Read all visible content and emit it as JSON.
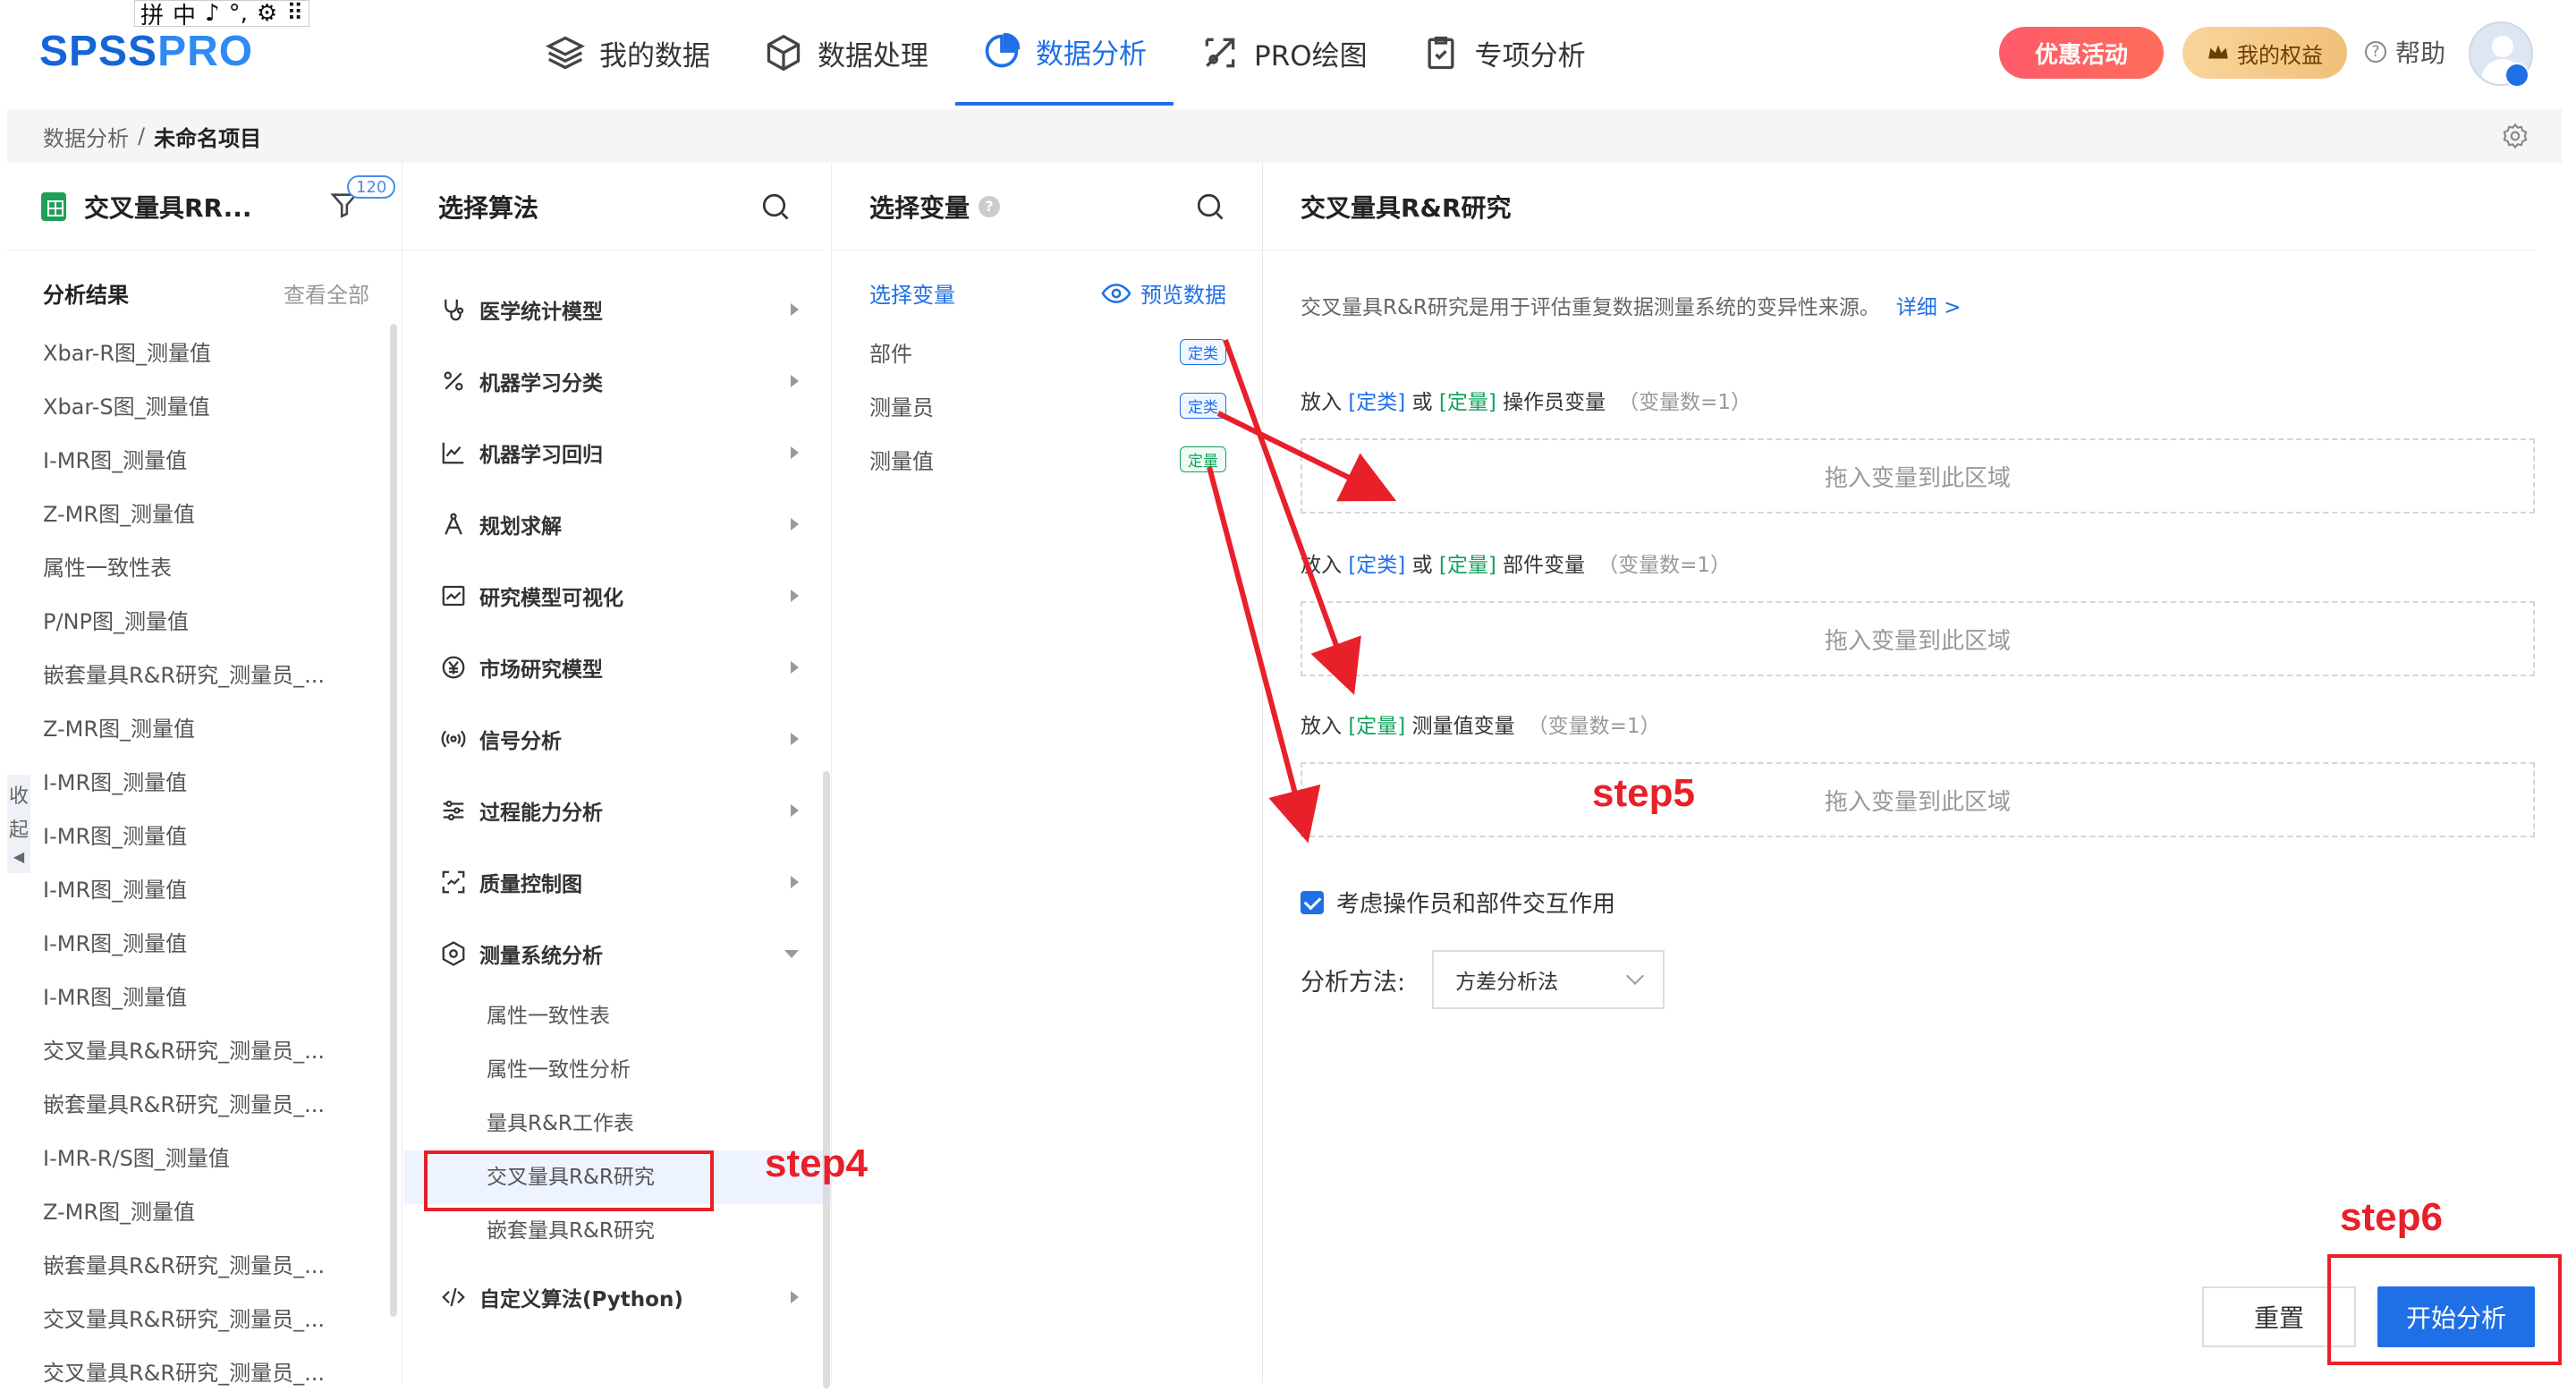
{
  "ime": {
    "items": [
      "拼",
      "中",
      "♪",
      "°,",
      "⚙",
      "⠿"
    ]
  },
  "logo": {
    "part1": "SPSS",
    "part2": "PRO"
  },
  "nav": {
    "items": [
      {
        "label": "我的数据",
        "icon": "layers-icon"
      },
      {
        "label": "数据处理",
        "icon": "cube-icon"
      },
      {
        "label": "数据分析",
        "icon": "pie-chart-icon",
        "active": true
      },
      {
        "label": "PRO绘图",
        "icon": "drawing-icon"
      },
      {
        "label": "专项分析",
        "icon": "clipboard-check-icon"
      }
    ],
    "promo": "优惠活动",
    "rights": "我的权益",
    "help": "帮助"
  },
  "breadcrumb": {
    "root": "数据分析",
    "sep": "/",
    "current": "未命名项目"
  },
  "project": {
    "name": "交叉量具RR...",
    "badge": "120"
  },
  "results": {
    "title": "分析结果",
    "view_all": "查看全部",
    "items": [
      "Xbar-R图_测量值",
      "Xbar-S图_测量值",
      "I-MR图_测量值",
      "Z-MR图_测量值",
      "属性一致性表",
      "P/NP图_测量值",
      "嵌套量具R&R研究_测量员_...",
      "Z-MR图_测量值",
      "I-MR图_测量值",
      "I-MR图_测量值",
      "I-MR图_测量值",
      "I-MR图_测量值",
      "I-MR图_测量值",
      "交叉量具R&R研究_测量员_...",
      "嵌套量具R&R研究_测量员_...",
      "I-MR-R/S图_测量值",
      "Z-MR图_测量值",
      "嵌套量具R&R研究_测量员_...",
      "交叉量具R&R研究_测量员_...",
      "交叉量具R&R研究_测量员_..."
    ],
    "collapse": [
      "收",
      "起"
    ]
  },
  "algorithms": {
    "title": "选择算法",
    "items": [
      {
        "label": "医学统计模型",
        "icon": "stethoscope-icon"
      },
      {
        "label": "机器学习分类",
        "icon": "percent-icon"
      },
      {
        "label": "机器学习回归",
        "icon": "trend-chart-icon"
      },
      {
        "label": "规划求解",
        "icon": "compass-icon"
      },
      {
        "label": "研究模型可视化",
        "icon": "line-chart-icon"
      },
      {
        "label": "市场研究模型",
        "icon": "yen-icon"
      },
      {
        "label": "信号分析",
        "icon": "signal-icon"
      },
      {
        "label": "过程能力分析",
        "icon": "sliders-icon"
      },
      {
        "label": "质量控制图",
        "icon": "scan-icon"
      },
      {
        "label": "测量系统分析",
        "icon": "gauge-icon",
        "expanded": true
      }
    ],
    "sub_items": [
      "属性一致性表",
      "属性一致性分析",
      "量具R&R工作表",
      "交叉量具R&R研究",
      "嵌套量具R&R研究"
    ],
    "last": {
      "label": "自定义算法(Python)",
      "icon": "code-icon"
    }
  },
  "variables": {
    "title": "选择变量",
    "select_label": "选择变量",
    "preview_label": "预览数据",
    "items": [
      {
        "name": "部件",
        "type": "定类"
      },
      {
        "name": "测量员",
        "type": "定类"
      },
      {
        "name": "测量值",
        "type": "定量"
      }
    ]
  },
  "config": {
    "title": "交叉量具R&R研究",
    "description": "交叉量具R&R研究是用于评估重复数据测量系统的变异性来源。",
    "detail_link": "详细 >",
    "zone_operator": {
      "prefix": "放入",
      "cat": "[定类]",
      "or": "或",
      "num": "[定量]",
      "suffix": "操作员变量",
      "count": "（变量数=1）"
    },
    "zone_part": {
      "prefix": "放入",
      "cat": "[定类]",
      "or": "或",
      "num": "[定量]",
      "suffix": "部件变量",
      "count": "（变量数=1）"
    },
    "zone_measure": {
      "prefix": "放入",
      "num": "[定量]",
      "suffix": "测量值变量",
      "count": "（变量数=1）"
    },
    "drop_placeholder": "拖入变量到此区域",
    "interaction_label": "考虑操作员和部件交互作用",
    "method_label": "分析方法:",
    "method_value": "方差分析法",
    "reset_label": "重置",
    "start_label": "开始分析"
  },
  "annotations": {
    "step4": "step4",
    "step5": "step5",
    "step6": "step6",
    "color": "#e8202a"
  }
}
